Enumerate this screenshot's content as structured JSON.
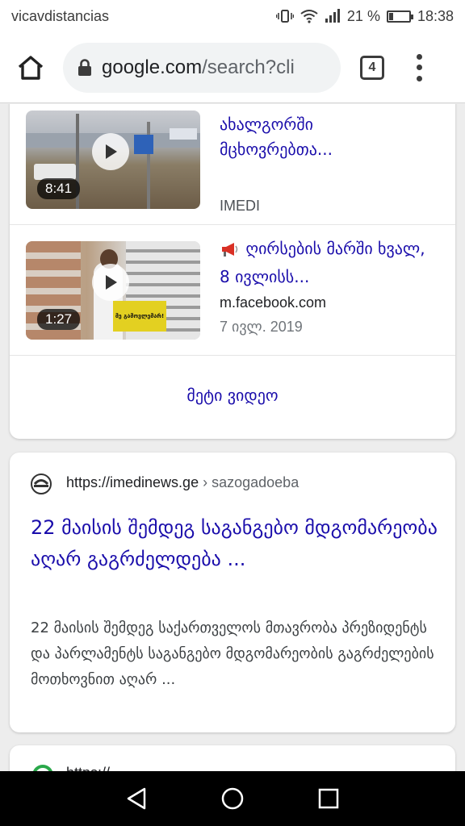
{
  "status_bar": {
    "carrier": "vicavdistancias",
    "battery_text": "21 %",
    "battery_level": 0.21,
    "time": "18:38"
  },
  "browser": {
    "url_host": "google.com",
    "url_path": "/search?cli",
    "tab_count": "4"
  },
  "videos": {
    "items": [
      {
        "title": "ახალგორში მცხოვრებთა...",
        "duration": "8:41",
        "source": "IMEDI",
        "date": ""
      },
      {
        "title": "ღირსების მარში ხვალ, 8 ივლისს...",
        "duration": "1:27",
        "source": "m.facebook.com",
        "date": "7 ივლ. 2019",
        "thumb_sign": "მე გამოვლემარ!"
      }
    ],
    "more_label": "მეტი ვიდეო"
  },
  "result": {
    "cite_url": "https://imedinews.ge",
    "cite_crumb": "› sazogadoeba",
    "title": "22 მაისის შემდეგ საგანგებო მდგომარეობა აღარ გაგრძელდება ...",
    "snippet": "22 მაისის შემდეგ საქართველოს მთავრობა პრეზიდენტს და პარლამენტს საგანგებო მდგომარეობის გაგრძელების მოთხოვნით აღარ ..."
  },
  "next_result": {
    "cite_url": "https://..."
  },
  "colors": {
    "link": "#1a0dab",
    "next_favicon": "#2aa84a"
  }
}
